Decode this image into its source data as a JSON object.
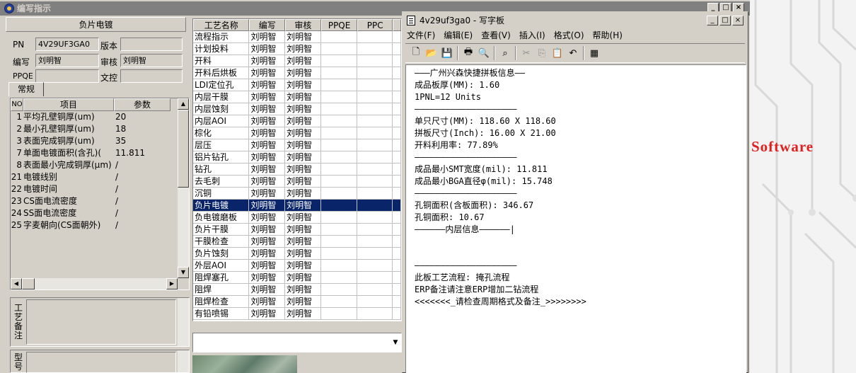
{
  "main_window": {
    "title": "编写指示"
  },
  "left_panel": {
    "section_title": "负片电镀",
    "pn_label": "PN",
    "pn_value": "4V29UF3GA0",
    "version_label": "版本",
    "version_value": "",
    "author_label": "编写",
    "author_value": "刘明智",
    "reviewer_label": "审核",
    "reviewer_value": "刘明智",
    "ppqe_label": "PPQE",
    "ppqe_value": "",
    "doc_label": "文控",
    "doc_value": "",
    "tab_label": "常规",
    "params_headers": [
      "NO",
      "项目",
      "参数"
    ],
    "params_rows": [
      {
        "no": "1",
        "item": "平均孔壁铜厚(um)",
        "value": "20"
      },
      {
        "no": "2",
        "item": "最小孔壁铜厚(um)",
        "value": "18"
      },
      {
        "no": "3",
        "item": "表面完成铜厚(um)",
        "value": "35"
      },
      {
        "no": "7",
        "item": "单面电镀面积(含孔)(",
        "value": "11.811"
      },
      {
        "no": "8",
        "item": "表面最小完成铜厚(μm)",
        "value": "/"
      },
      {
        "no": "21",
        "item": "电镀线别",
        "value": "/"
      },
      {
        "no": "22",
        "item": "电镀时间",
        "value": "/"
      },
      {
        "no": "23",
        "item": "CS面电流密度",
        "value": "/"
      },
      {
        "no": "24",
        "item": "SS面电流密度",
        "value": "/"
      },
      {
        "no": "25",
        "item": "字麦朝向(CS面朝外)",
        "value": "/"
      }
    ],
    "remark_label": "工艺备注",
    "model_label": "型号"
  },
  "process_grid": {
    "headers": [
      "工艺名称",
      "编写",
      "审核",
      "PPQE",
      "PPC",
      ""
    ],
    "rows": [
      {
        "name": "流程指示",
        "author": "刘明智",
        "reviewer": "刘明智"
      },
      {
        "name": "计划投料",
        "author": "刘明智",
        "reviewer": "刘明智"
      },
      {
        "name": "开料",
        "author": "刘明智",
        "reviewer": "刘明智"
      },
      {
        "name": "开料后烘板",
        "author": "刘明智",
        "reviewer": "刘明智"
      },
      {
        "name": "LDI定位孔",
        "author": "刘明智",
        "reviewer": "刘明智"
      },
      {
        "name": "内层干膜",
        "author": "刘明智",
        "reviewer": "刘明智"
      },
      {
        "name": "内层蚀刻",
        "author": "刘明智",
        "reviewer": "刘明智"
      },
      {
        "name": "内层AOI",
        "author": "刘明智",
        "reviewer": "刘明智"
      },
      {
        "name": "棕化",
        "author": "刘明智",
        "reviewer": "刘明智"
      },
      {
        "name": "层压",
        "author": "刘明智",
        "reviewer": "刘明智"
      },
      {
        "name": "铝片钻孔",
        "author": "刘明智",
        "reviewer": "刘明智"
      },
      {
        "name": "钻孔",
        "author": "刘明智",
        "reviewer": "刘明智"
      },
      {
        "name": "去毛刺",
        "author": "刘明智",
        "reviewer": "刘明智"
      },
      {
        "name": "沉铜",
        "author": "刘明智",
        "reviewer": "刘明智"
      },
      {
        "name": "负片电镀",
        "author": "刘明智",
        "reviewer": "刘明智",
        "selected": true
      },
      {
        "name": "负电镀磨板",
        "author": "刘明智",
        "reviewer": "刘明智"
      },
      {
        "name": "负片干膜",
        "author": "刘明智",
        "reviewer": "刘明智"
      },
      {
        "name": "干膜检查",
        "author": "刘明智",
        "reviewer": "刘明智"
      },
      {
        "name": "负片蚀刻",
        "author": "刘明智",
        "reviewer": "刘明智"
      },
      {
        "name": "外层AOI",
        "author": "刘明智",
        "reviewer": "刘明智"
      },
      {
        "name": "阻焊塞孔",
        "author": "刘明智",
        "reviewer": "刘明智"
      },
      {
        "name": "阻焊",
        "author": "刘明智",
        "reviewer": "刘明智"
      },
      {
        "name": "阻焊检查",
        "author": "刘明智",
        "reviewer": "刘明智"
      },
      {
        "name": "有铅喷锡",
        "author": "刘明智",
        "reviewer": "刘明智"
      }
    ]
  },
  "wordpad": {
    "title": "4v29uf3ga0 - 写字板",
    "menu": [
      "文件(F)",
      "编辑(E)",
      "查看(V)",
      "插入(I)",
      "格式(O)",
      "帮助(H)"
    ],
    "toolbar_icons": [
      "new-icon",
      "open-icon",
      "save-icon",
      "print-icon",
      "print-preview-icon",
      "find-icon",
      "cut-icon",
      "copy-icon",
      "paste-icon",
      "undo-icon",
      "datetime-icon"
    ],
    "document_lines": [
      "———广州兴森快捷拼板信息——",
      "成品板厚(MM): 1.60",
      "1PNL=12 Units",
      "————————————————————",
      "单只尺寸(MM): 118.60 X 118.60",
      "拼板尺寸(Inch): 16.00 X 21.00",
      "开料利用率: 77.89%",
      "————————————————————",
      "成品最小SMT宽度(mil): 11.811",
      "成品最小BGA直径φ(mil): 15.748",
      "————————————————————",
      "孔铜面积(含板面积): 346.67",
      "孔铜面积: 10.67",
      "——————内层信息——————|",
      "",
      "",
      "————————————————————",
      "此板工艺流程: 掩孔流程",
      "ERP备注请注意ERP增加二钻流程",
      "<<<<<<<_请检查周期格式及备注_>>>>>>>>"
    ]
  },
  "desktop": {
    "brand_text": "Software"
  }
}
